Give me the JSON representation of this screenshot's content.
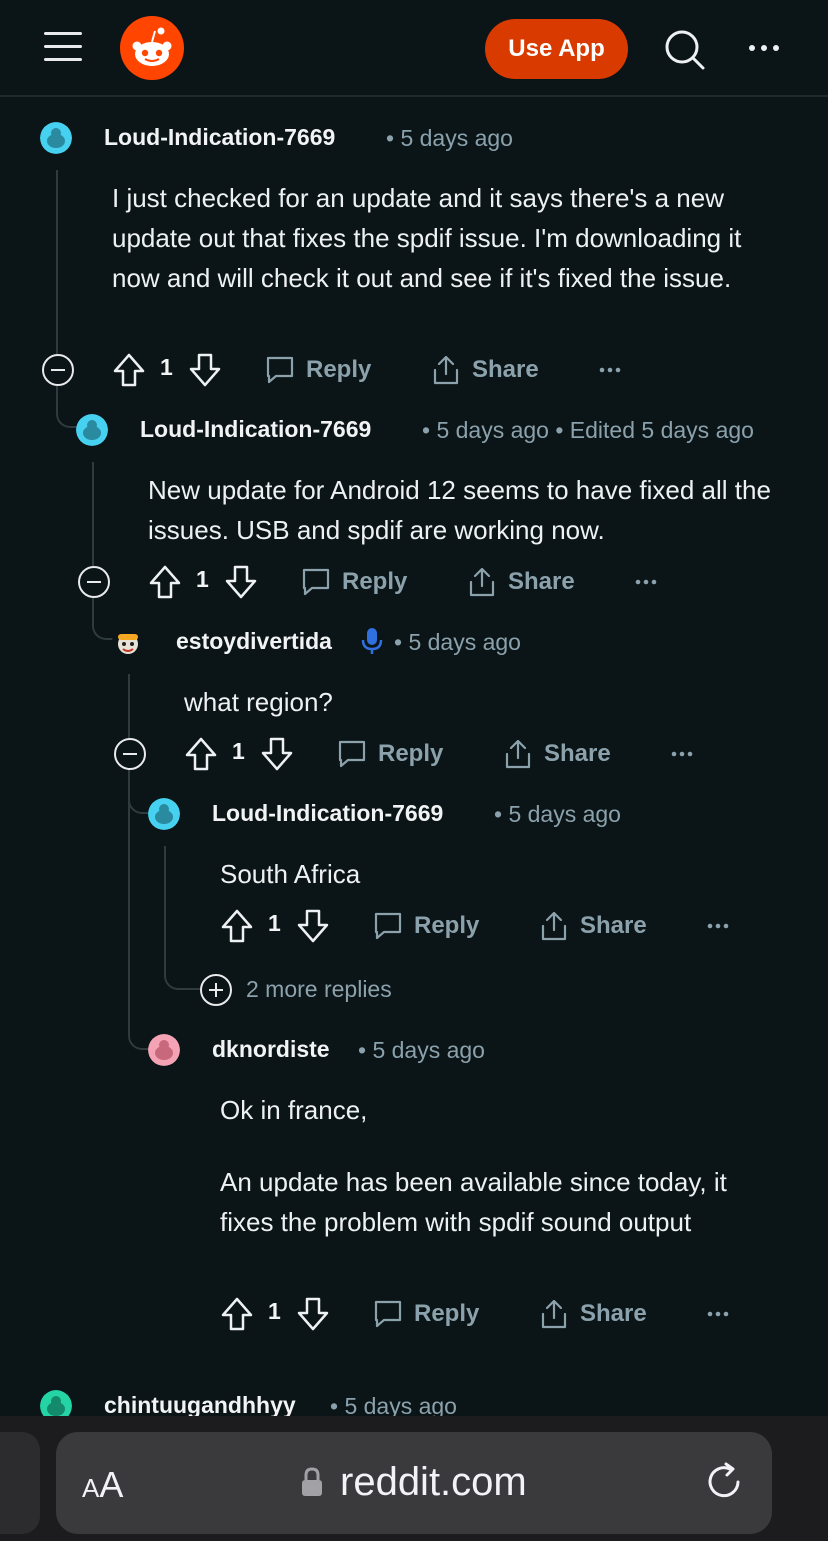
{
  "header": {
    "use_app_label": "Use App"
  },
  "comments": [
    {
      "username": "Loud-Indication-7669",
      "meta": "• 5 days ago",
      "body": "I just checked for an update and it says there's a new update out that fixes the spdif issue. I'm downloading it now and will check it out and see if it's fixed the issue.",
      "votes": "1",
      "reply_label": "Reply",
      "share_label": "Share",
      "avatar_color": "#46d1f0"
    },
    {
      "username": "Loud-Indication-7669",
      "meta": "• 5 days ago • Edited 5 days ago",
      "body": "New update for Android 12 seems to have fixed all the issues. USB and spdif are working now.",
      "votes": "1",
      "reply_label": "Reply",
      "share_label": "Share",
      "avatar_color": "#46d1f0"
    },
    {
      "username": "estoydivertida",
      "meta": "• 5 days ago",
      "body": "what region?",
      "votes": "1",
      "reply_label": "Reply",
      "share_label": "Share",
      "avatar_color": "#f5a623"
    },
    {
      "username": "Loud-Indication-7669",
      "meta": "• 5 days ago",
      "body": "South Africa",
      "votes": "1",
      "reply_label": "Reply",
      "share_label": "Share",
      "avatar_color": "#46d1f0"
    },
    {
      "username": "dknordiste",
      "meta": "• 5 days ago",
      "body_lines": [
        "Ok in france,",
        "An update has been available since today, it fixes the problem with spdif sound output"
      ],
      "votes": "1",
      "reply_label": "Reply",
      "share_label": "Share",
      "avatar_color": "#f4a3b4"
    },
    {
      "username": "chintuugandhhyy",
      "meta": "• 5 days ago",
      "avatar_color": "#24d4a4"
    }
  ],
  "more_replies_label": "2 more replies",
  "browser": {
    "text_size_label_small": "A",
    "text_size_label_large": "A",
    "url": "reddit.com"
  },
  "colors": {
    "background": "#0b1416",
    "accent": "#d93a00",
    "muted_text": "#8ba2ad"
  }
}
